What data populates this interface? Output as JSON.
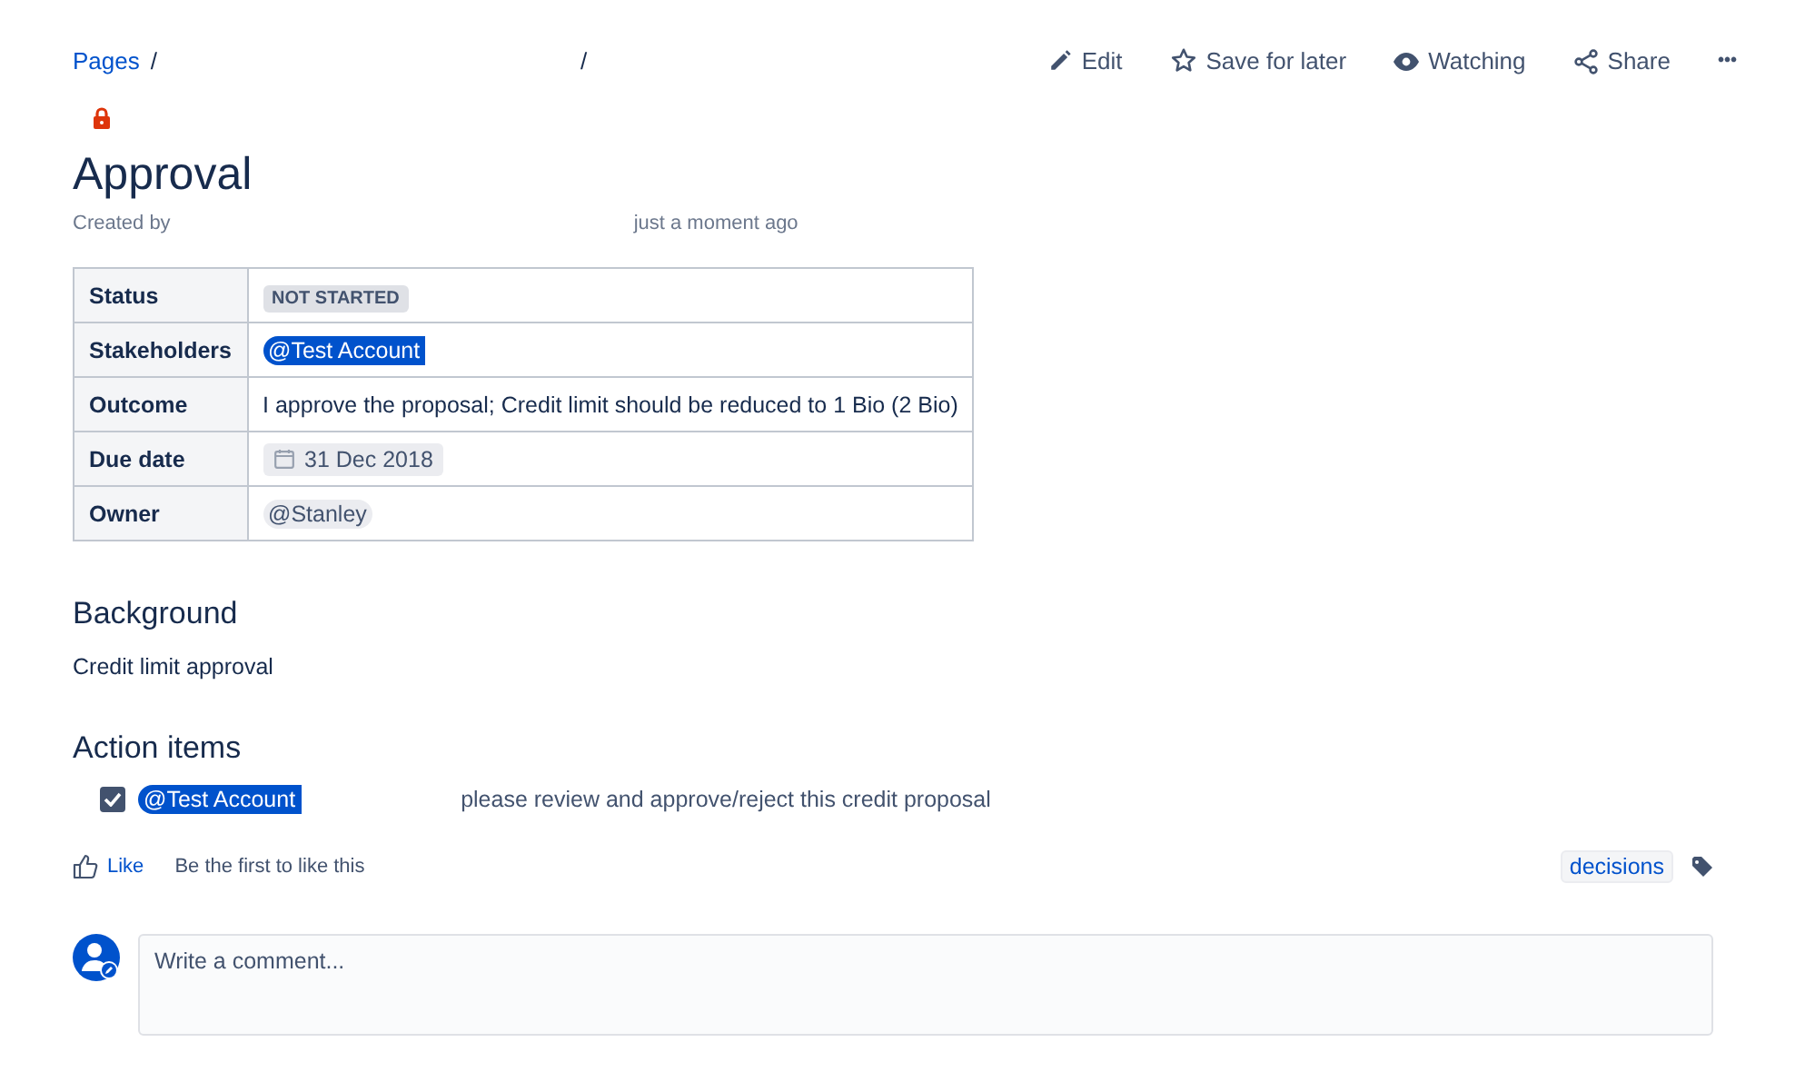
{
  "breadcrumb": {
    "link": "Pages",
    "separators": [
      "/",
      "/"
    ]
  },
  "actions": [
    {
      "label": "Edit",
      "kind": "edit"
    },
    {
      "label": "Save for later",
      "kind": "star"
    },
    {
      "label": "Watching",
      "kind": "eye"
    },
    {
      "label": "Share",
      "kind": "share"
    },
    {
      "label": "•••",
      "kind": "more"
    }
  ],
  "restricted": true,
  "title": "Approval",
  "byline": {
    "created_by": "Created by",
    "time": "just a moment ago"
  },
  "properties": [
    {
      "label": "Status",
      "kind": "status",
      "value": "NOT STARTED"
    },
    {
      "label": "Stakeholders",
      "kind": "mention",
      "value": "@Test Account",
      "highlighted": true
    },
    {
      "label": "Outcome",
      "kind": "text",
      "value": "I approve the proposal; Credit limit should be reduced to 1 Bio (2 Bio)"
    },
    {
      "label": "Due date",
      "kind": "date",
      "value": "31 Dec 2018"
    },
    {
      "label": "Owner",
      "kind": "mention",
      "value": "@Stanley",
      "highlighted": false
    }
  ],
  "sections": [
    {
      "heading": "Background",
      "text": "Credit limit approval"
    }
  ],
  "action_items": {
    "heading": "Action items",
    "items": [
      {
        "checked": true,
        "mention": "@Test Account",
        "highlighted": true,
        "text": "please review and approve/reject this credit proposal"
      }
    ]
  },
  "like": {
    "label": "Like",
    "text": "Be the first to like this"
  },
  "labels": [
    "decisions"
  ],
  "comment": {
    "placeholder": "Write a comment..."
  }
}
